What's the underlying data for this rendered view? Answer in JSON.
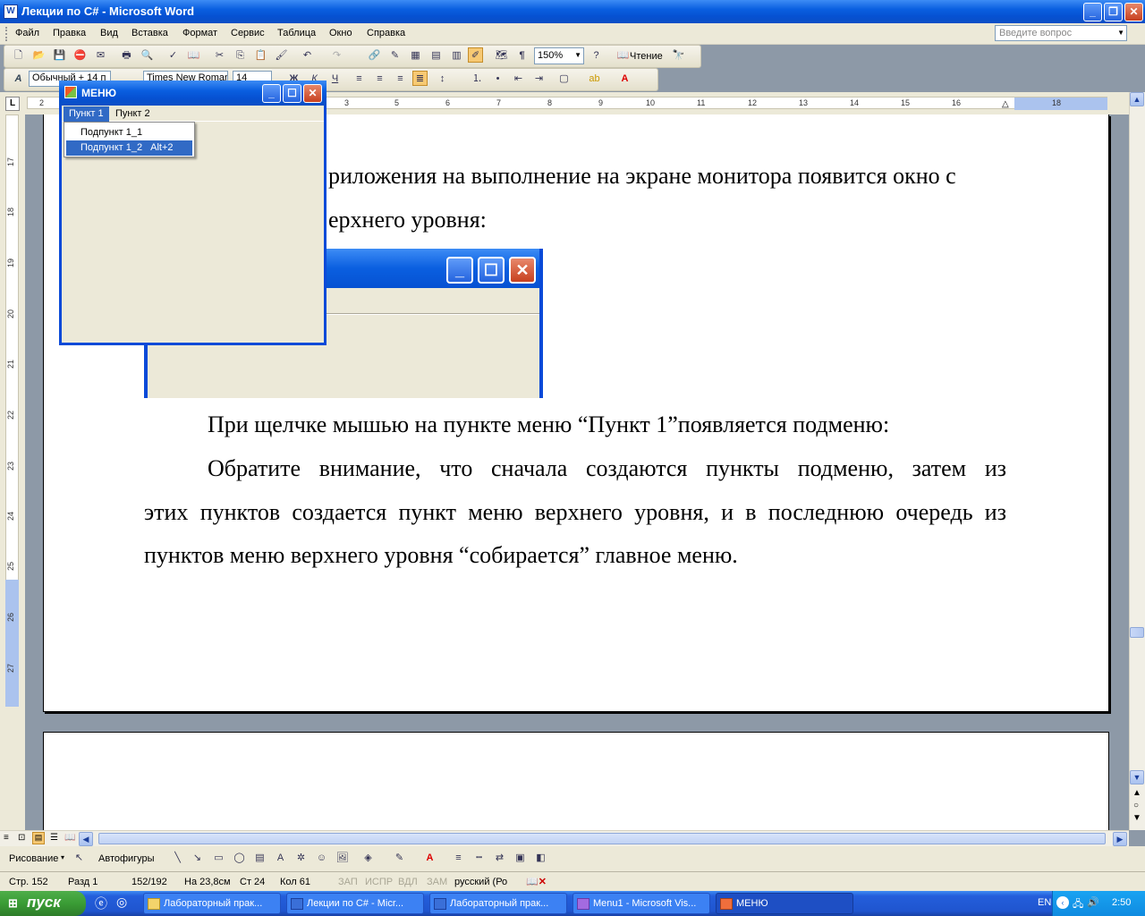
{
  "window": {
    "title": "Лекции по C# - Microsoft Word",
    "app_icon": "W"
  },
  "menubar": {
    "items": [
      "Файл",
      "Правка",
      "Вид",
      "Вставка",
      "Формат",
      "Сервис",
      "Таблица",
      "Окно",
      "Справка"
    ],
    "ask_placeholder": "Введите вопрос"
  },
  "toolbar": {
    "zoom": "150%",
    "reading_label": "Чтение",
    "style": "Обычный + 14 п",
    "font": "Times New Roman",
    "size": "14"
  },
  "ruler": {
    "h_numbers": [
      "2",
      "1",
      "1",
      "2",
      "3",
      "4",
      "5",
      "6",
      "7",
      "8",
      "9",
      "10",
      "11",
      "12",
      "13",
      "14",
      "15",
      "16",
      "17",
      "18"
    ],
    "v_numbers": [
      "17",
      "18",
      "19",
      "20",
      "21",
      "22",
      "23",
      "24",
      "25",
      "26",
      "27"
    ]
  },
  "document": {
    "line1": "риложения на выполнение  на экране монитора появится окно с",
    "line2": "ерхнего уровня:",
    "para2": "При щелчке мышью на пункте меню “Пункт 1”появляется подменю:",
    "para3_l1": "Обратите внимание, что сначала создаются пункты подменю, затем из",
    "para3_l2": "этих пунктов создается пункт меню верхнего уровня, и в последнюю очередь из",
    "para3_l3": "пунктов меню верхнего уровня “собирается” главное меню."
  },
  "app_window": {
    "title": "МЕНЮ",
    "menu": [
      "Пункт 1",
      "Пункт 2"
    ],
    "submenu": [
      {
        "label": "Подпункт 1_1",
        "shortcut": ""
      },
      {
        "label": "Подпункт 1_2",
        "shortcut": "Alt+2",
        "selected": true
      }
    ]
  },
  "drawbar": {
    "draw_label": "Рисование",
    "autoshapes_label": "Автофигуры"
  },
  "status": {
    "page": "Стр.  152",
    "section": "Разд  1",
    "pages": "152/192",
    "at": "На 23,8см",
    "line": "Ст  24",
    "col": "Кол  61",
    "rec": "ЗАП",
    "trk": "ИСПР",
    "ext": "ВДЛ",
    "ovr": "ЗАМ",
    "lang": "русский (Ро"
  },
  "taskbar": {
    "start_label": "пуск",
    "tasks": [
      {
        "label": "Лабораторный прак...",
        "active": false
      },
      {
        "label": "Лекции по C# - Micr...",
        "active": false
      },
      {
        "label": "Лабораторный прак...",
        "active": false
      },
      {
        "label": "Menu1 - Microsoft Vis...",
        "active": false
      },
      {
        "label": "МЕНЮ",
        "active": true
      }
    ],
    "lang": "EN",
    "clock": "2:50"
  },
  "colors": {
    "xp_blue": "#0a5fe0",
    "selection": "#316ac5",
    "start_green": "#3a9c35"
  }
}
